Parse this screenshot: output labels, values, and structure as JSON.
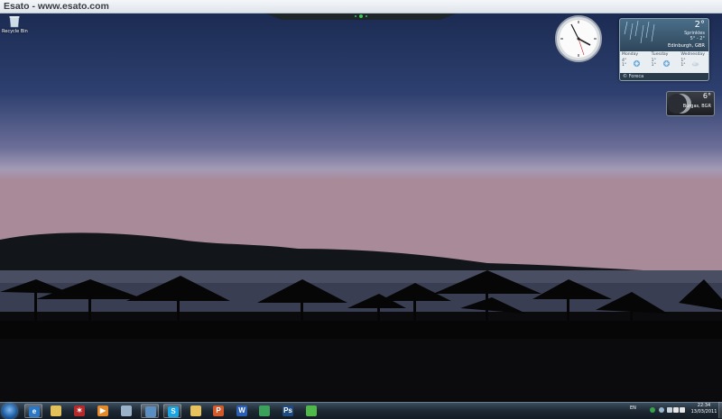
{
  "watermark": "Esato - www.esato.com",
  "desktop": {
    "recycle_bin_label": "Recycle Bin"
  },
  "weather": {
    "current_temp": "2°",
    "condition": "Sprinkles",
    "range": "5° - 2°",
    "location": "Edinburgh, GBR",
    "source": "© Foreca",
    "forecast": [
      {
        "day": "Monday",
        "high": "4°",
        "low": "1°"
      },
      {
        "day": "Tuesday",
        "high": "1°",
        "low": "1°"
      },
      {
        "day": "Wednesday",
        "high": "1°",
        "low": "1°"
      }
    ]
  },
  "moon_gadget": {
    "temp": "6°",
    "location": "Burgas, BGR"
  },
  "taskbar": {
    "apps": [
      {
        "name": "internet-explorer-icon",
        "glyph": "e",
        "color": "#2a78c8",
        "active": true
      },
      {
        "name": "windows-explorer-icon",
        "glyph": "",
        "color": "#e3c15a",
        "active": false
      },
      {
        "name": "app-3-icon",
        "glyph": "✶",
        "color": "#b52a2a",
        "active": false
      },
      {
        "name": "media-player-icon",
        "glyph": "▶",
        "color": "#e58a2a",
        "active": false
      },
      {
        "name": "app-5-icon",
        "glyph": "",
        "color": "#9ab3c8",
        "active": false
      },
      {
        "name": "app-6-icon",
        "glyph": "",
        "color": "#5a8fc4",
        "active": true
      },
      {
        "name": "skype-icon",
        "glyph": "S",
        "color": "#17a5e6",
        "active": true
      },
      {
        "name": "folder-icon",
        "glyph": "",
        "color": "#e8c25c",
        "active": false
      },
      {
        "name": "powerpoint-icon",
        "glyph": "P",
        "color": "#d35a2a",
        "active": false
      },
      {
        "name": "word-icon",
        "glyph": "W",
        "color": "#2b5fb4",
        "active": false
      },
      {
        "name": "app-11-icon",
        "glyph": "",
        "color": "#3aa05a",
        "active": false
      },
      {
        "name": "photoshop-icon",
        "glyph": "Ps",
        "color": "#1f4c80",
        "active": false
      },
      {
        "name": "spotify-icon",
        "glyph": "",
        "color": "#4fb848",
        "active": false
      }
    ],
    "language": "EN",
    "time": "22:34",
    "date": "13/03/2011"
  }
}
